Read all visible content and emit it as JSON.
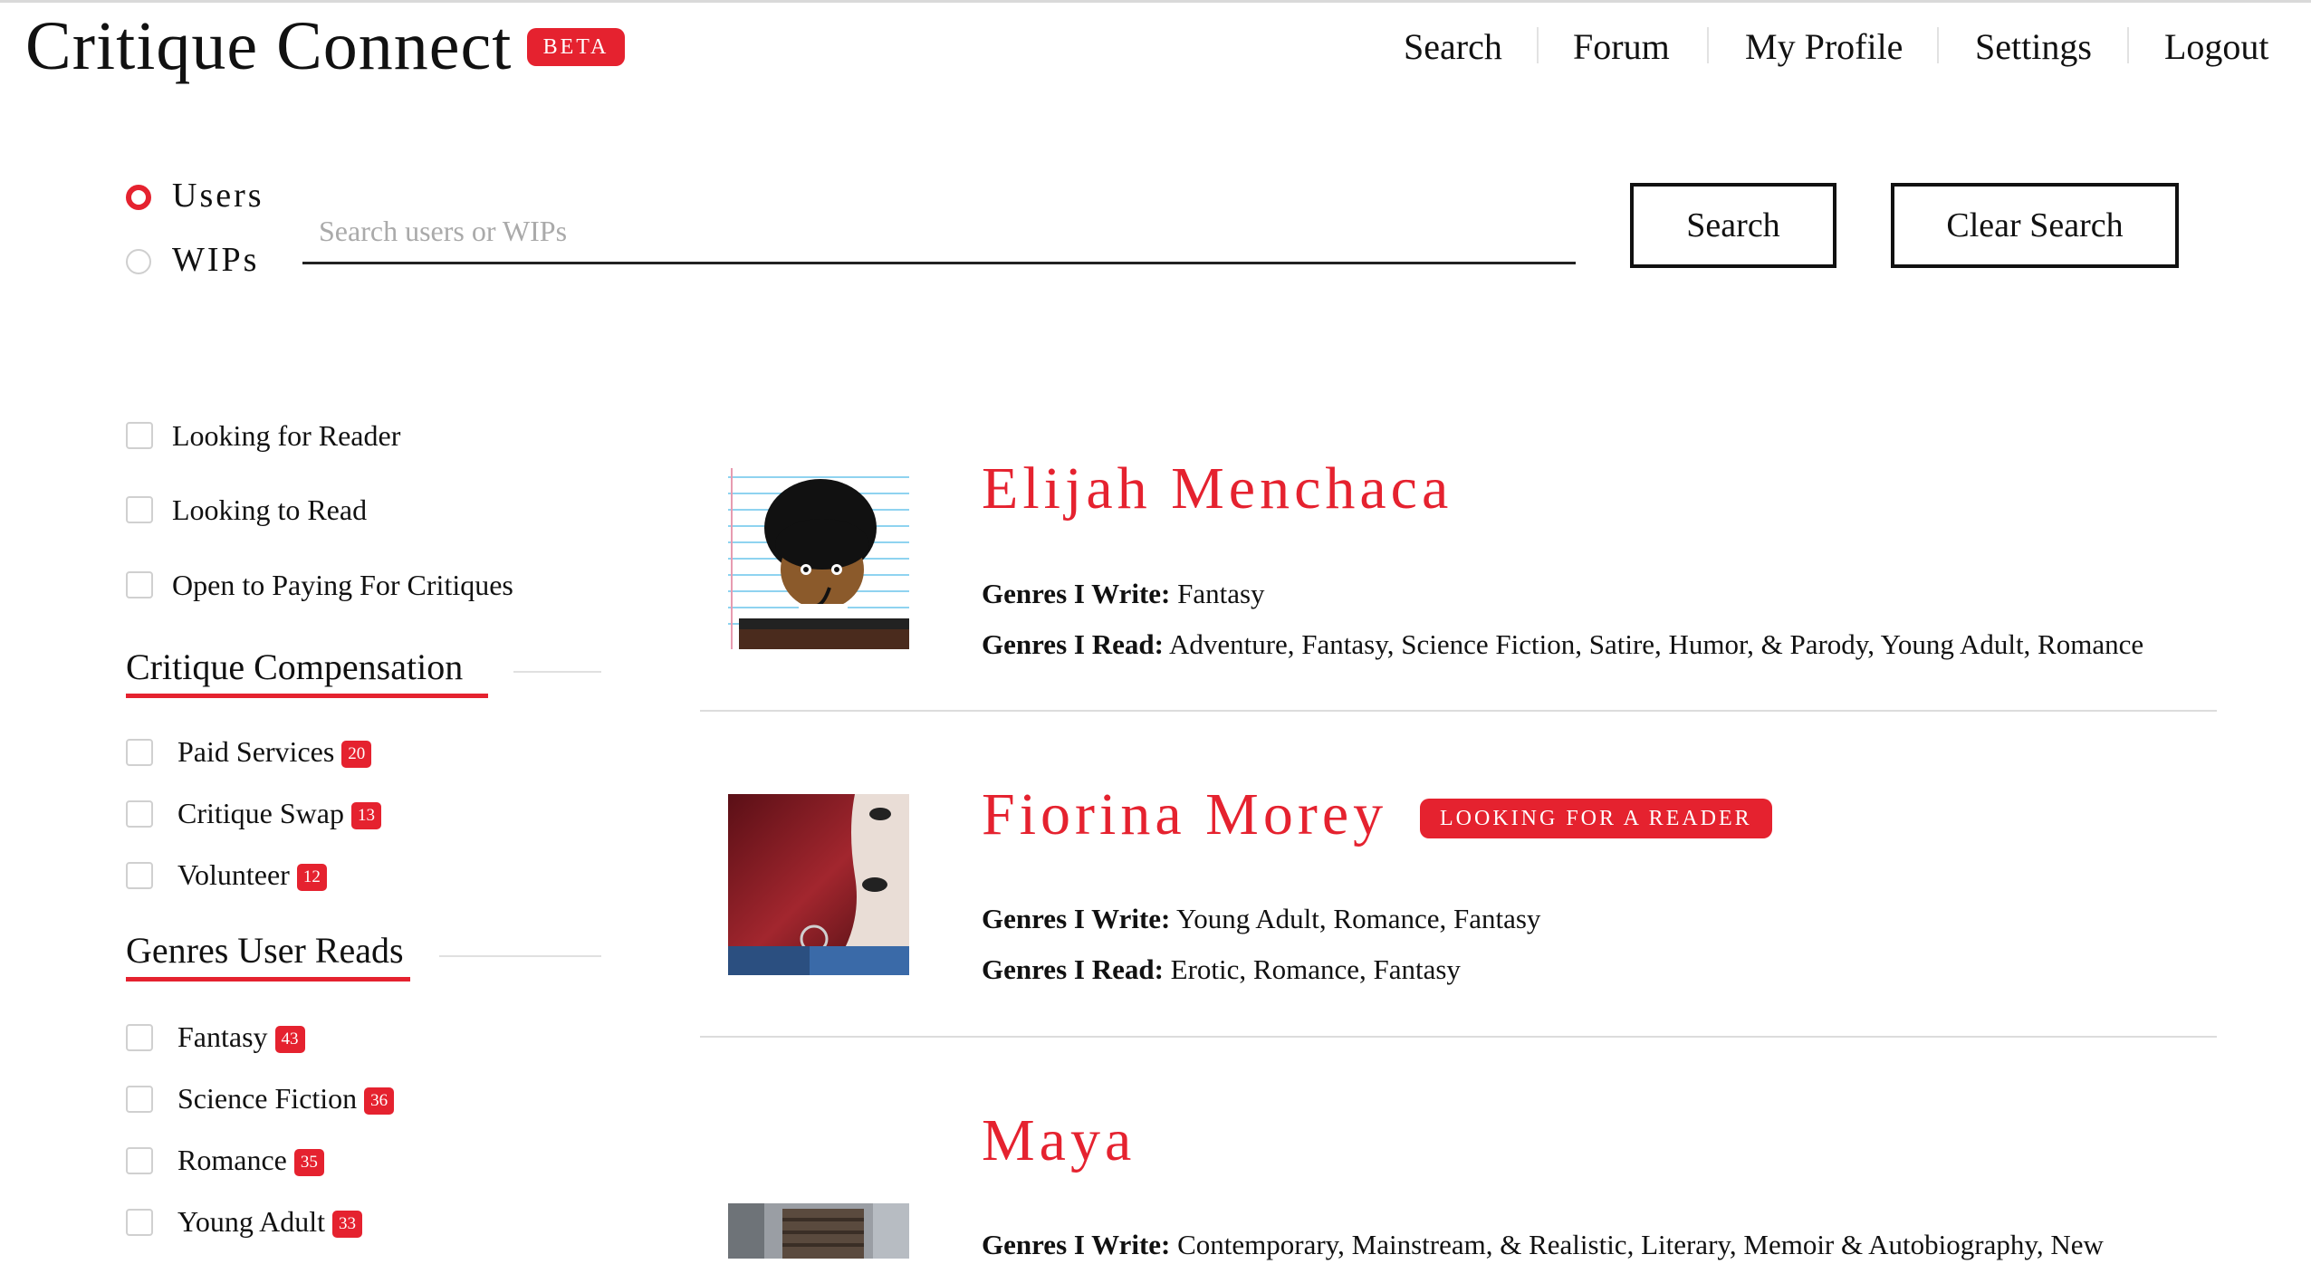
{
  "app": {
    "name": "Critique Connect",
    "badge": "BETA"
  },
  "nav": {
    "items": [
      "Search",
      "Forum",
      "My Profile",
      "Settings",
      "Logout"
    ]
  },
  "search": {
    "modes": [
      {
        "label": "Users",
        "selected": true
      },
      {
        "label": "WIPs",
        "selected": false
      }
    ],
    "placeholder": "Search users or WIPs",
    "value": "",
    "search_button": "Search",
    "clear_button": "Clear Search"
  },
  "filters": {
    "toggles": [
      "Looking for Reader",
      "Looking to Read",
      "Open to Paying For Critiques"
    ],
    "compensation": {
      "title": "Critique Compensation",
      "items": [
        {
          "label": "Paid Services",
          "count": "20"
        },
        {
          "label": "Critique Swap",
          "count": "13"
        },
        {
          "label": "Volunteer",
          "count": "12"
        }
      ]
    },
    "genres": {
      "title": "Genres User Reads",
      "items": [
        {
          "label": "Fantasy",
          "count": "43"
        },
        {
          "label": "Science Fiction",
          "count": "36"
        },
        {
          "label": "Romance",
          "count": "35"
        },
        {
          "label": "Young Adult",
          "count": "33"
        }
      ]
    }
  },
  "results": {
    "write_label": "Genres I Write:",
    "read_label": "Genres I Read:",
    "users": [
      {
        "name": "Elijah Menchaca",
        "tag": "",
        "writes": "Fantasy",
        "reads": "Adventure, Fantasy, Science Fiction, Satire, Humor, & Parody, Young Adult, Romance"
      },
      {
        "name": "Fiorina Morey",
        "tag": "LOOKING FOR A READER",
        "writes": "Young Adult, Romance, Fantasy",
        "reads": "Erotic, Romance, Fantasy"
      },
      {
        "name": "Maya",
        "tag": "",
        "writes": "Contemporary, Mainstream, & Realistic, Literary, Memoir & Autobiography, New",
        "reads": ""
      }
    ]
  },
  "colors": {
    "accent": "#e5222f",
    "text": "#111111",
    "muted": "#aaaaaa"
  }
}
